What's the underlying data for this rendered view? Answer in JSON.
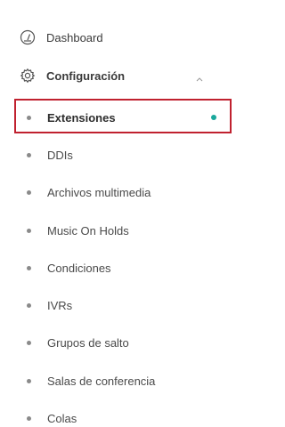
{
  "nav": {
    "dashboard": {
      "label": "Dashboard",
      "icon": "dashboard-gauge-icon"
    },
    "configuracion": {
      "label": "Configuración",
      "icon": "gear-icon",
      "expanded_icon": "chevron-up-icon"
    },
    "sub_items": [
      {
        "label": "Extensiones",
        "active": true
      },
      {
        "label": "DDIs"
      },
      {
        "label": "Archivos multimedia"
      },
      {
        "label": "Music On Holds"
      },
      {
        "label": "Condiciones"
      },
      {
        "label": "IVRs"
      },
      {
        "label": "Grupos de salto"
      },
      {
        "label": "Salas de conferencia"
      },
      {
        "label": "Colas"
      }
    ]
  },
  "colors": {
    "active_dot": "#1aa89c",
    "highlight_border": "#c0212f"
  }
}
